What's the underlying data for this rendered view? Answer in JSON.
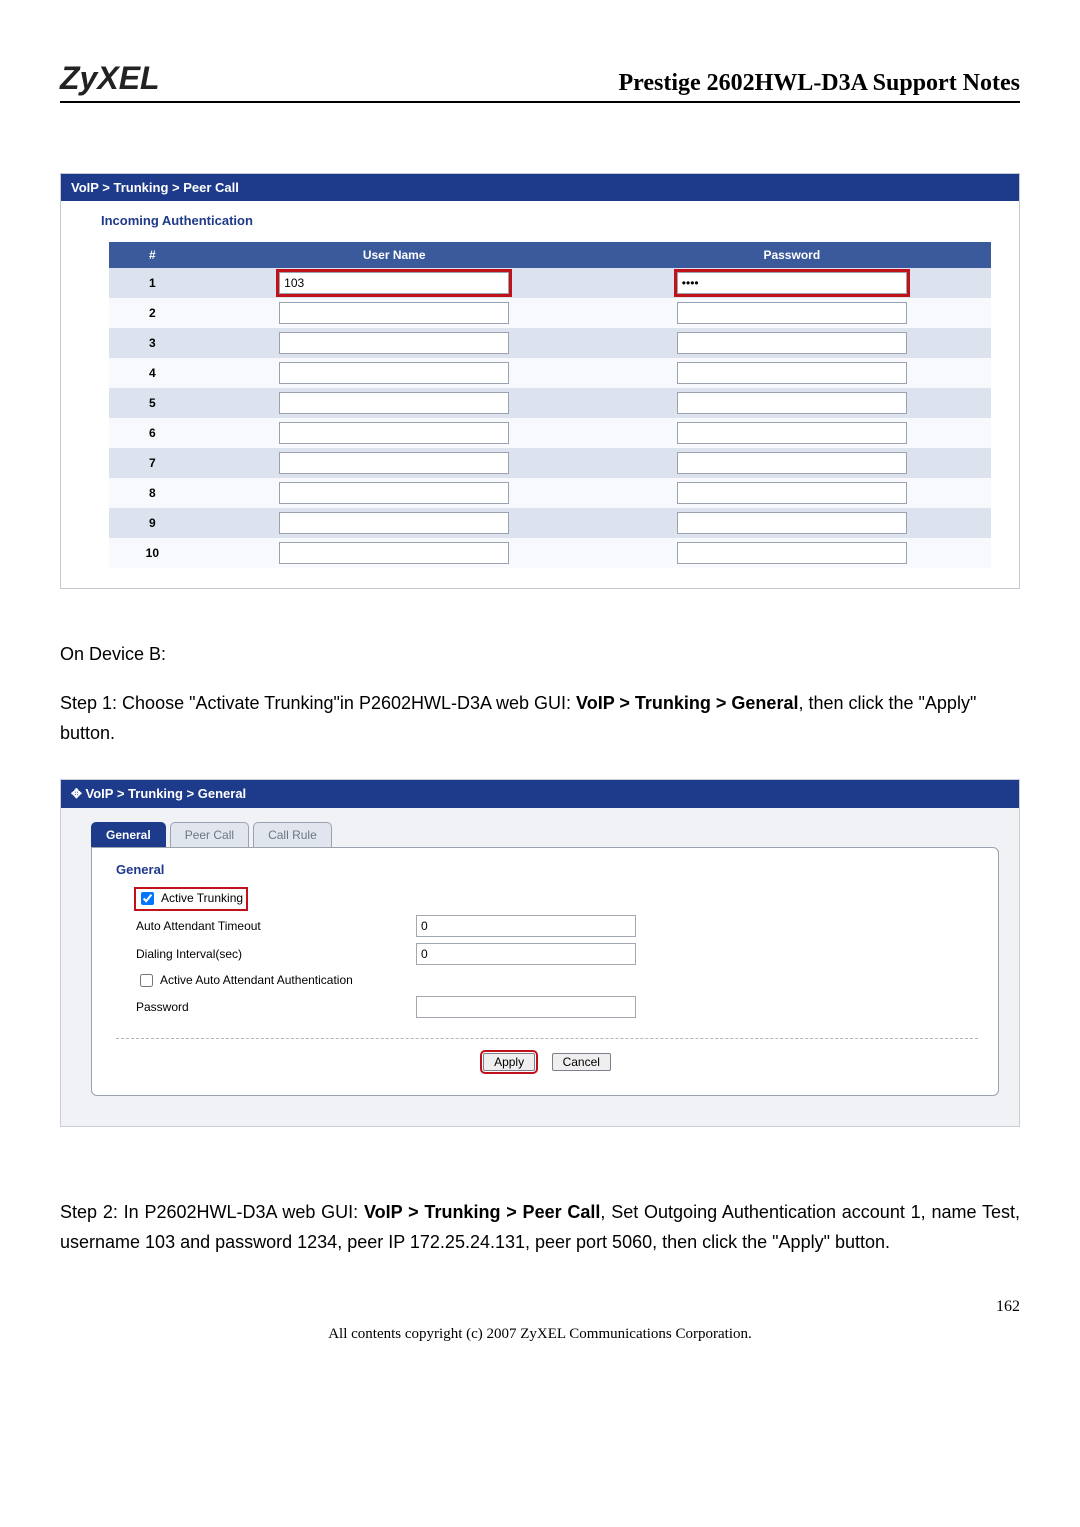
{
  "header": {
    "logo": "ZyXEL",
    "title": "Prestige 2602HWL-D3A Support Notes"
  },
  "panel1": {
    "crumb": "VoIP > Trunking > Peer Call",
    "subtitle": "Incoming Authentication",
    "columns": {
      "idx": "#",
      "user": "User Name",
      "pass": "Password"
    },
    "rows": [
      {
        "n": "1",
        "user": "103",
        "pass": "••••"
      },
      {
        "n": "2",
        "user": "",
        "pass": ""
      },
      {
        "n": "3",
        "user": "",
        "pass": ""
      },
      {
        "n": "4",
        "user": "",
        "pass": ""
      },
      {
        "n": "5",
        "user": "",
        "pass": ""
      },
      {
        "n": "6",
        "user": "",
        "pass": ""
      },
      {
        "n": "7",
        "user": "",
        "pass": ""
      },
      {
        "n": "8",
        "user": "",
        "pass": ""
      },
      {
        "n": "9",
        "user": "",
        "pass": ""
      },
      {
        "n": "10",
        "user": "",
        "pass": ""
      }
    ]
  },
  "text1": {
    "on_device": "On Device B:",
    "step1_a": "Step  1: Choose \"Activate Trunking\"in P2602HWL-D3A web GUI: ",
    "step1_b": "VoIP > Trunking > General",
    "step1_c": ", then click the \"Apply\" button."
  },
  "panel2": {
    "crumb_icon": "✥",
    "crumb": "VoIP > Trunking > General",
    "tabs": {
      "general": "General",
      "peer": "Peer Call",
      "rule": "Call Rule"
    },
    "section": "General",
    "labels": {
      "active_trunking": "Active Trunking",
      "auto_timeout": "Auto Attendant Timeout",
      "dialing_interval": "Dialing Interval(sec)",
      "active_auth": "Active Auto Attendant Authentication",
      "password": "Password"
    },
    "values": {
      "auto_timeout": "0",
      "dialing_interval": "0",
      "password": ""
    },
    "buttons": {
      "apply": "Apply",
      "cancel": "Cancel"
    }
  },
  "text2": {
    "step2_a": "Step  2: In P2602HWL-D3A web GUI: ",
    "step2_b": "VoIP > Trunking > Peer Call",
    "step2_c": ", Set Outgoing Authentication account 1, name Test, username 103 and password 1234, peer IP 172.25.24.131, peer port 5060, then click the \"Apply\" button."
  },
  "footer": {
    "page": "162",
    "copyright": "All contents copyright (c) 2007 ZyXEL Communications Corporation."
  }
}
